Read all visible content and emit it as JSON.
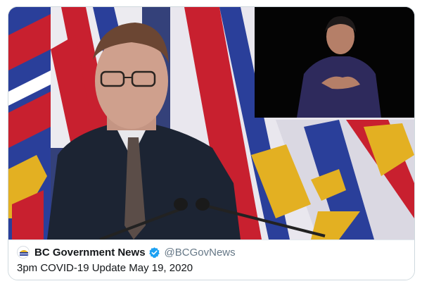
{
  "tweet_card": {
    "account_name": "BC Government News",
    "handle": "@BCGovNews",
    "video_title": "3pm COVID-19 Update May 19, 2020",
    "avatar_icon": "bc-government-logo-icon",
    "verified_icon": "verified-badge-icon"
  },
  "colors": {
    "verified_blue": "#1da1f2",
    "name_text": "#14171a",
    "handle_text": "#657786",
    "card_border": "#cfd9de"
  }
}
